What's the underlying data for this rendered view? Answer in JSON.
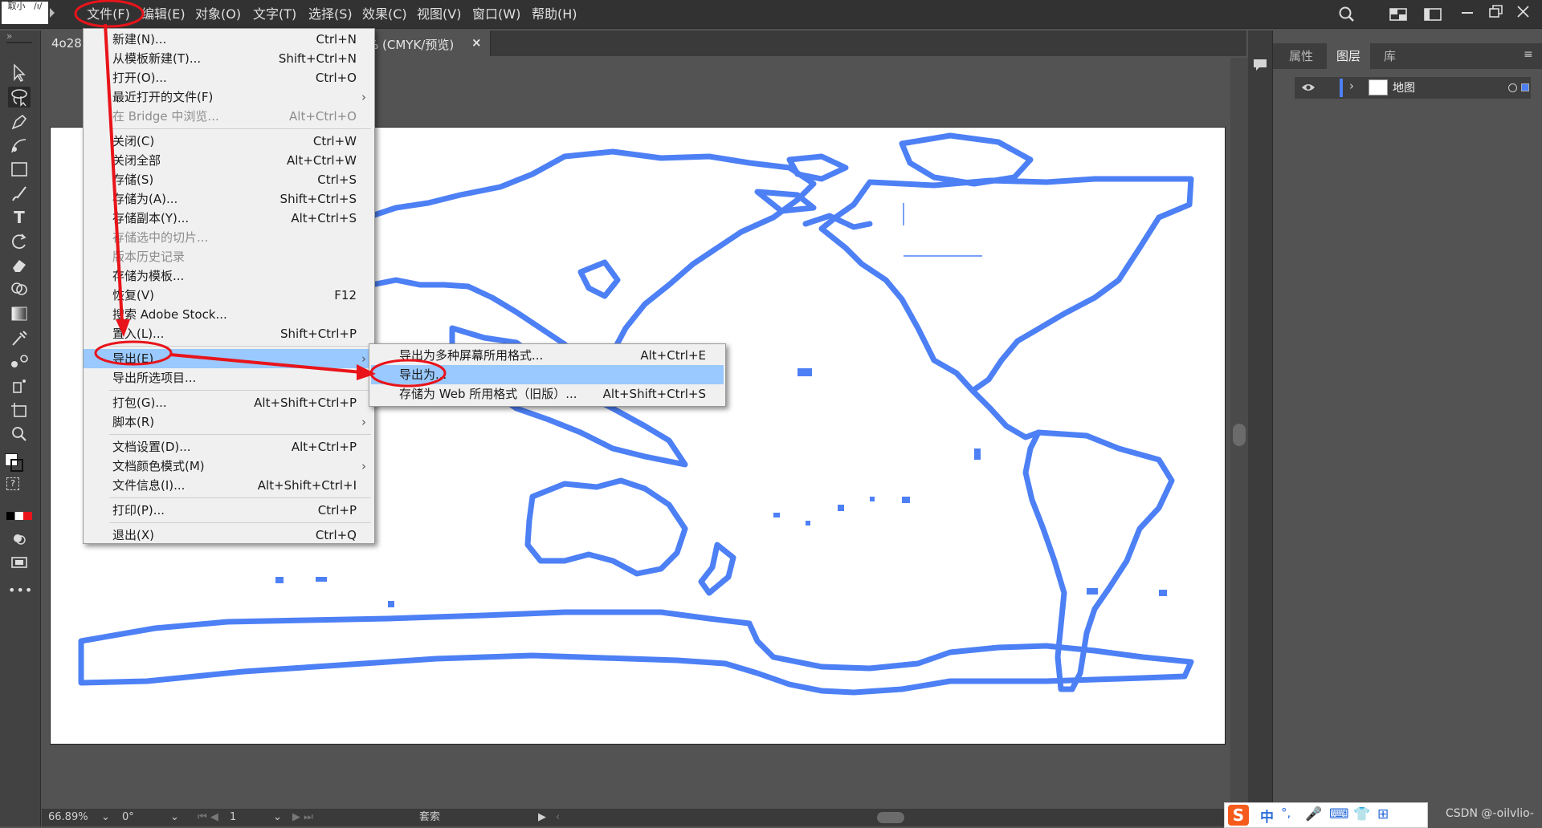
{
  "app": {
    "logo_text": "取小   /ı/",
    "colors": {
      "accent_red": "#e8141a",
      "menu_highlight": "#99c9ff",
      "map_blue": "#4d80f5"
    }
  },
  "menubar": {
    "items": [
      "文件(F)",
      "编辑(E)",
      "对象(O)",
      "文字(T)",
      "选择(S)",
      "效果(C)",
      "视图(V)",
      "窗口(W)",
      "帮助(H)"
    ]
  },
  "document_tab": {
    "left_fragment": "4o28",
    "title_fragment": "% (CMYK/预览)",
    "close": "×"
  },
  "file_menu": {
    "items": [
      {
        "label": "新建(N)...",
        "shortcut": "Ctrl+N",
        "disabled": false
      },
      {
        "label": "从模板新建(T)...",
        "shortcut": "Shift+Ctrl+N",
        "disabled": false
      },
      {
        "label": "打开(O)...",
        "shortcut": "Ctrl+O",
        "disabled": false
      },
      {
        "label": "最近打开的文件(F)",
        "shortcut": "",
        "submenu": true,
        "disabled": false
      },
      {
        "label": "在 Bridge 中浏览...",
        "shortcut": "Alt+Ctrl+O",
        "disabled": true
      },
      {
        "separator": true
      },
      {
        "label": "关闭(C)",
        "shortcut": "Ctrl+W",
        "disabled": false
      },
      {
        "label": "关闭全部",
        "shortcut": "Alt+Ctrl+W",
        "disabled": false
      },
      {
        "label": "存储(S)",
        "shortcut": "Ctrl+S",
        "disabled": false
      },
      {
        "label": "存储为(A)...",
        "shortcut": "Shift+Ctrl+S",
        "disabled": false
      },
      {
        "label": "存储副本(Y)...",
        "shortcut": "Alt+Ctrl+S",
        "disabled": false
      },
      {
        "label": "存储选中的切片...",
        "shortcut": "",
        "disabled": true
      },
      {
        "label": "版本历史记录",
        "shortcut": "",
        "disabled": true
      },
      {
        "label": "存储为模板...",
        "shortcut": "",
        "disabled": false
      },
      {
        "label": "恢复(V)",
        "shortcut": "F12",
        "disabled": false
      },
      {
        "label": "搜索 Adobe Stock...",
        "shortcut": "",
        "disabled": false
      },
      {
        "label": "置入(L)...",
        "shortcut": "Shift+Ctrl+P",
        "disabled": false
      },
      {
        "separator": true
      },
      {
        "label": "导出(E)",
        "shortcut": "",
        "submenu": true,
        "highlighted": true,
        "disabled": false
      },
      {
        "label": "导出所选项目...",
        "shortcut": "",
        "disabled": false
      },
      {
        "separator": true
      },
      {
        "label": "打包(G)...",
        "shortcut": "Alt+Shift+Ctrl+P",
        "disabled": false
      },
      {
        "label": "脚本(R)",
        "shortcut": "",
        "submenu": true,
        "disabled": false
      },
      {
        "separator": true
      },
      {
        "label": "文档设置(D)...",
        "shortcut": "Alt+Ctrl+P",
        "disabled": false
      },
      {
        "label": "文档颜色模式(M)",
        "shortcut": "",
        "submenu": true,
        "disabled": false
      },
      {
        "label": "文件信息(I)...",
        "shortcut": "Alt+Shift+Ctrl+I",
        "disabled": false
      },
      {
        "separator": true
      },
      {
        "label": "打印(P)...",
        "shortcut": "Ctrl+P",
        "disabled": false
      },
      {
        "separator": true
      },
      {
        "label": "退出(X)",
        "shortcut": "Ctrl+Q",
        "disabled": false
      }
    ]
  },
  "export_submenu": {
    "items": [
      {
        "label": "导出为多种屏幕所用格式...",
        "shortcut": "Alt+Ctrl+E"
      },
      {
        "label": "导出为...",
        "shortcut": "",
        "highlighted": true
      },
      {
        "label": "存储为 Web 所用格式（旧版）...",
        "shortcut": "Alt+Shift+Ctrl+S"
      }
    ]
  },
  "right_panel": {
    "tabs": [
      "属性",
      "图层",
      "库"
    ],
    "active_tab": "图层",
    "layers": [
      {
        "name": "地图"
      }
    ]
  },
  "statusbar": {
    "zoom": "66.89%",
    "rotation": "0°",
    "artboard_number": "1",
    "tool_name": "套索"
  },
  "ime": {
    "mode": "中",
    "punct": "°,"
  },
  "watermark": "CSDN @-oilvlio-"
}
